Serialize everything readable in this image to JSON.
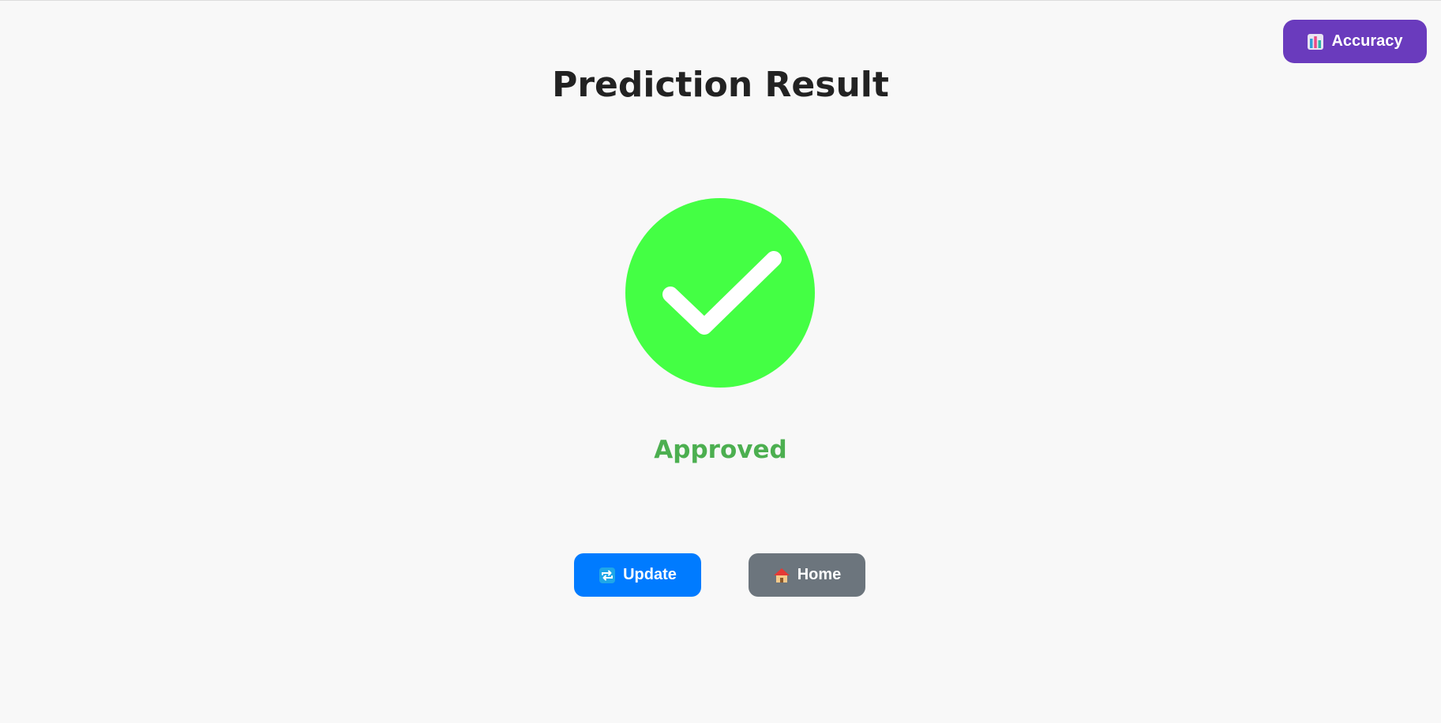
{
  "header": {
    "title": "Prediction Result"
  },
  "accuracy_button": {
    "label": "Accuracy",
    "icon": "bar-chart-icon"
  },
  "result": {
    "icon": "check-circle-icon",
    "status": "Approved"
  },
  "actions": {
    "update": {
      "label": "Update",
      "icon": "repeat-icon"
    },
    "home": {
      "label": "Home",
      "icon": "house-icon"
    }
  },
  "colors": {
    "background": "#f8f8f8",
    "title": "#222222",
    "accuracy_button": "#6a3bbd",
    "check_circle": "#44ff44",
    "status_approved": "#4caf50",
    "update_button": "#007bff",
    "home_button": "#6c757d"
  }
}
